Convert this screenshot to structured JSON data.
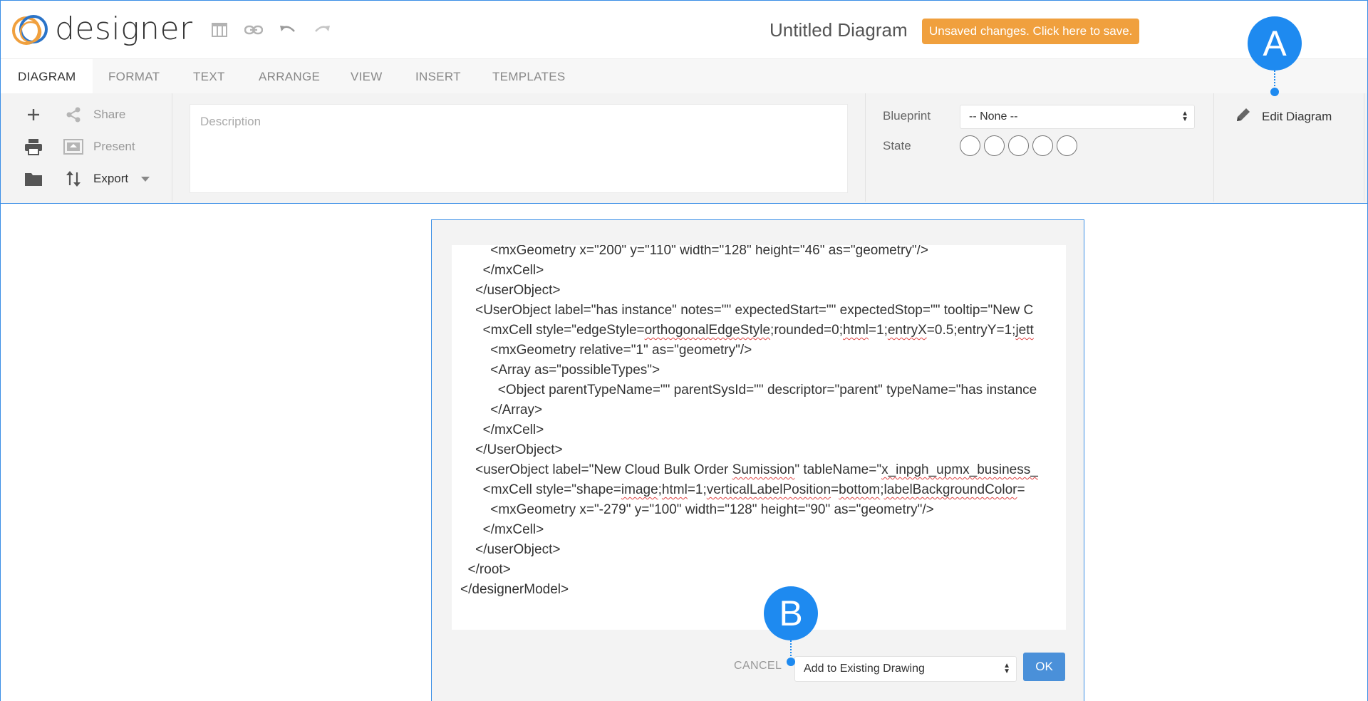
{
  "app": {
    "logo_text": "designer",
    "doc_title": "Untitled Diagram",
    "unsaved_label": "Unsaved changes. Click here to save.",
    "toolbar_icons": [
      "table-icon",
      "link-icon",
      "undo-icon",
      "redo-icon"
    ]
  },
  "tabs": [
    {
      "label": "DIAGRAM",
      "active": true
    },
    {
      "label": "FORMAT",
      "active": false
    },
    {
      "label": "TEXT",
      "active": false
    },
    {
      "label": "ARRANGE",
      "active": false
    },
    {
      "label": "VIEW",
      "active": false
    },
    {
      "label": "INSERT",
      "active": false
    },
    {
      "label": "TEMPLATES",
      "active": false
    }
  ],
  "ribbon": {
    "share_label": "Share",
    "present_label": "Present",
    "export_label": "Export",
    "description_placeholder": "Description",
    "blueprint_label": "Blueprint",
    "blueprint_value": "-- None --",
    "state_label": "State",
    "state_count": 5,
    "edit_diagram_label": "Edit Diagram"
  },
  "dialog": {
    "code_lines": [
      "        <mxGeometry x=\"200\" y=\"110\" width=\"128\" height=\"46\" as=\"geometry\"/>",
      "      </mxCell>",
      "    </userObject>",
      "    <UserObject label=\"has instance\" notes=\"\" expectedStart=\"\" expectedStop=\"\" tooltip=\"New C",
      "      <mxCell style=\"edgeStyle=orthogonalEdgeStyle;rounded=0;html=1;entryX=0.5;entryY=1;jett",
      "        <mxGeometry relative=\"1\" as=\"geometry\"/>",
      "        <Array as=\"possibleTypes\">",
      "          <Object parentTypeName=\"\" parentSysId=\"\" descriptor=\"parent\" typeName=\"has instance",
      "        </Array>",
      "      </mxCell>",
      "    </UserObject>",
      "    <userObject label=\"New Cloud Bulk Order Sumission\" tableName=\"x_inpgh_upmx_business_",
      "      <mxCell style=\"shape=image;html=1;verticalLabelPosition=bottom;labelBackgroundColor=",
      "        <mxGeometry x=\"-279\" y=\"100\" width=\"128\" height=\"90\" as=\"geometry\"/>",
      "      </mxCell>",
      "    </userObject>",
      "  </root>",
      "</designerModel>"
    ],
    "cancel_label": "CANCEL",
    "mode_value": "Add to Existing Drawing",
    "ok_label": "OK"
  },
  "callouts": {
    "a_label": "A",
    "b_label": "B"
  },
  "colors": {
    "accent": "#3a8ee6",
    "unsaved": "#f0a03e",
    "callout": "#1e8af0",
    "ok_button": "#4a90d9"
  }
}
